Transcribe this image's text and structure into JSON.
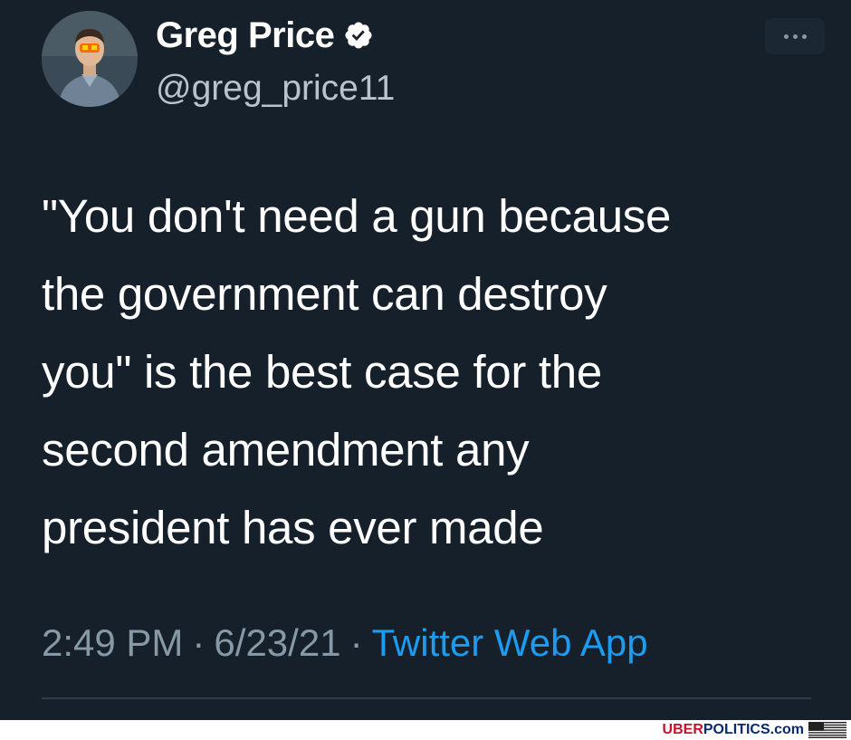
{
  "tweet": {
    "display_name": "Greg Price",
    "handle": "@greg_price11",
    "verified_icon": "verified-badge-icon",
    "more_icon": "more-options-icon",
    "text_lines": [
      "\"You don't need a gun because",
      "the government can destroy",
      "you\" is the best case for the",
      "second amendment any",
      "president has ever made"
    ],
    "time": "2:49 PM",
    "date": "6/23/21",
    "separator": "·",
    "source": "Twitter Web App"
  },
  "watermark": {
    "part1": "UBER",
    "part2": "POLITICS.com",
    "flag_icon": "us-flag-icon"
  },
  "colors": {
    "background": "#15202b",
    "text": "#ffffff",
    "secondary_text": "#8899a6",
    "link": "#1d9bf0"
  }
}
